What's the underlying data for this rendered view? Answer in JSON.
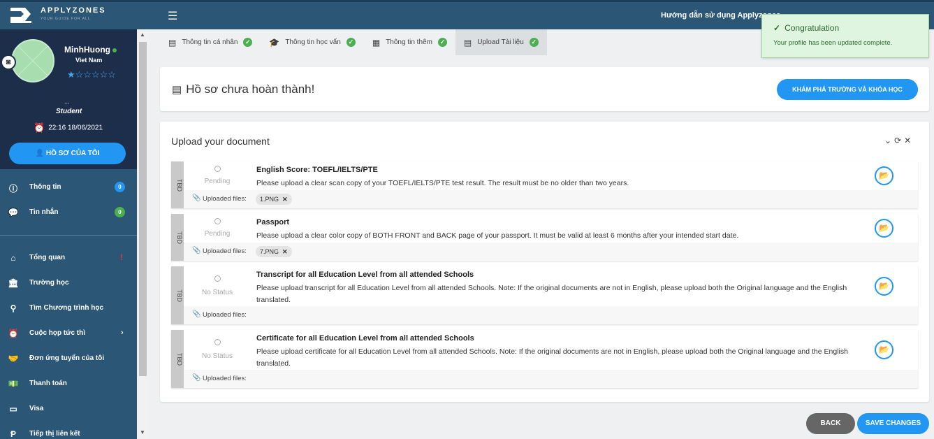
{
  "header": {
    "logo_text": "APPLYZONES",
    "logo_tagline": "YOUR GUIDE FOR ALL",
    "guide_link": "Hướng dẫn sử dụng Applyzones"
  },
  "profile": {
    "name": "MinhHuong",
    "country": "Viet Nam",
    "rating_stars": "★☆☆☆☆☆",
    "dots": "...",
    "role": "Student",
    "datetime": "22:16 18/06/2021",
    "button": "HỒ SƠ CỦA TÔI"
  },
  "sidebar": {
    "items": [
      {
        "label": "Thông tin",
        "icon": "info-icon",
        "badge": "0"
      },
      {
        "label": "Tin nhắn",
        "icon": "chat-icon",
        "badge": "0"
      },
      {
        "label": "Tổng quan",
        "icon": "home-icon"
      },
      {
        "label": "Trường học",
        "icon": "bank-icon"
      },
      {
        "label": "Tìm Chương trình học",
        "icon": "search-icon"
      },
      {
        "label": "Cuộc họp tức thì",
        "icon": "clock-icon"
      },
      {
        "label": "Đơn ứng tuyển của tôi",
        "icon": "handshake-icon"
      },
      {
        "label": "Thanh toán",
        "icon": "money-icon"
      },
      {
        "label": "Visa",
        "icon": "card-icon"
      },
      {
        "label": "Tiếp thị liên kết",
        "icon": "affiliate-icon"
      }
    ]
  },
  "tabs": [
    {
      "label": "Thông tin cá nhân",
      "icon": "id-card-icon"
    },
    {
      "label": "Thông tin học vấn",
      "icon": "graduation-cap-icon"
    },
    {
      "label": "Thông tin thêm",
      "icon": "notes-icon"
    },
    {
      "label": "Upload Tài liệu",
      "icon": "upload-doc-icon"
    }
  ],
  "status_card": {
    "title": "Hồ sơ chưa hoàn thành!",
    "explore_button": "KHÁM PHÁ TRƯỜNG VÀ KHÓA HỌC"
  },
  "upload": {
    "title": "Upload your document",
    "uploaded_label": "Uploaded files:",
    "side_tag": "TBD",
    "documents": [
      {
        "status": "Pending",
        "title": "English Score: TOEFL/IELTS/PTE",
        "description": "Please upload a clear scan copy of your TOEFL/IELTS/PTE test result. The result must be no older than two years.",
        "file": "1.PNG"
      },
      {
        "status": "Pending",
        "title": "Passport",
        "description": "Please upload a clear color copy of BOTH FRONT and BACK page of your passport. It must be valid at least 6 months after your intended start date.",
        "file": "7.PNG"
      },
      {
        "status": "No Status",
        "title": "Transcript for all Education Level from all attended Schools",
        "description": "Please upload transcript for all Education Level from all attended Schools. Note: If the original documents are not in English, please upload both the Original language and the English translated.",
        "file": ""
      },
      {
        "status": "No Status",
        "title": "Certificate for all Education Level from all attended Schools",
        "description": "Please upload certificate for all Education Level from all attended Schools. Note: If the original documents are not in English, please upload both the Original language and the English translated.",
        "file": ""
      }
    ]
  },
  "footer": {
    "back": "BACK",
    "save": "SAVE CHANGES"
  },
  "toast": {
    "title": "Congratulation",
    "message": "Your profile has been updated complete."
  },
  "colors": {
    "primary": "#2196f3",
    "sidebar": "#2b5676",
    "profile_bg": "#1c2e4a",
    "success": "#4caf50"
  }
}
